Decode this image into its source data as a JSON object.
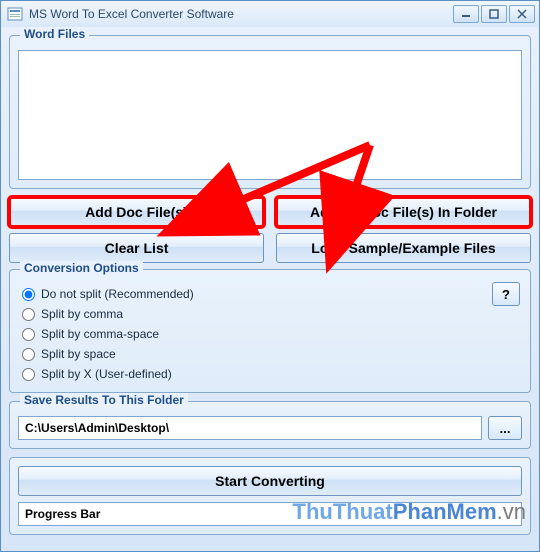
{
  "window": {
    "title": "MS Word To Excel Converter Software"
  },
  "section": {
    "files_legend": "Word Files",
    "options_legend": "Conversion Options",
    "save_legend": "Save Results To This Folder"
  },
  "buttons": {
    "add_files": "Add Doc File(s)",
    "add_folder": "Add All Doc File(s) In Folder",
    "clear_list": "Clear List",
    "load_sample": "Load Sample/Example Files",
    "help": "?",
    "browse": "...",
    "start": "Start Converting"
  },
  "options": {
    "opt1": "Do not split (Recommended)",
    "opt2": "Split by comma",
    "opt3": "Split by comma-space",
    "opt4": "Split by space",
    "opt5": "Split by X (User-defined)"
  },
  "save": {
    "path": "C:\\Users\\Admin\\Desktop\\"
  },
  "progress": {
    "label": "Progress Bar"
  },
  "watermark": {
    "p1": "ThuThuat",
    "p2": "PhanMem",
    "p3": ".vn"
  }
}
